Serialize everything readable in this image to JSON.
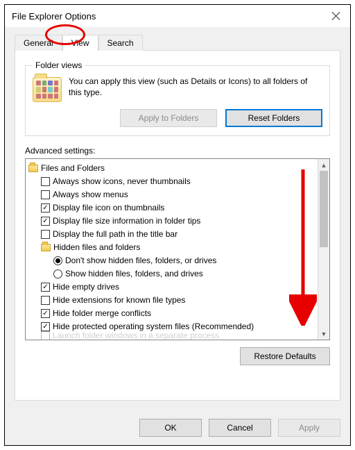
{
  "window": {
    "title": "File Explorer Options"
  },
  "tabs": {
    "general": "General",
    "view": "View",
    "search": "Search",
    "active": "view"
  },
  "folderViews": {
    "legend": "Folder views",
    "text": "You can apply this view (such as Details or Icons) to all folders of this type.",
    "applyBtn": "Apply to Folders",
    "resetBtn": "Reset Folders"
  },
  "advanced": {
    "label": "Advanced settings:",
    "rootLabel": "Files and Folders",
    "items": [
      {
        "kind": "check",
        "checked": false,
        "label": "Always show icons, never thumbnails"
      },
      {
        "kind": "check",
        "checked": false,
        "label": "Always show menus"
      },
      {
        "kind": "check",
        "checked": true,
        "label": "Display file icon on thumbnails"
      },
      {
        "kind": "check",
        "checked": true,
        "label": "Display file size information in folder tips"
      },
      {
        "kind": "check",
        "checked": false,
        "label": "Display the full path in the title bar"
      },
      {
        "kind": "folder",
        "label": "Hidden files and folders"
      },
      {
        "kind": "radio",
        "selected": true,
        "label": "Don't show hidden files, folders, or drives"
      },
      {
        "kind": "radio",
        "selected": false,
        "label": "Show hidden files, folders, and drives"
      },
      {
        "kind": "check",
        "checked": true,
        "label": "Hide empty drives"
      },
      {
        "kind": "check",
        "checked": false,
        "label": "Hide extensions for known file types"
      },
      {
        "kind": "check",
        "checked": true,
        "label": "Hide folder merge conflicts"
      },
      {
        "kind": "check",
        "checked": true,
        "label": "Hide protected operating system files (Recommended)"
      }
    ],
    "cutoff": "Launch folder windows in a separate process"
  },
  "restore": "Restore Defaults",
  "buttons": {
    "ok": "OK",
    "cancel": "Cancel",
    "apply": "Apply"
  }
}
